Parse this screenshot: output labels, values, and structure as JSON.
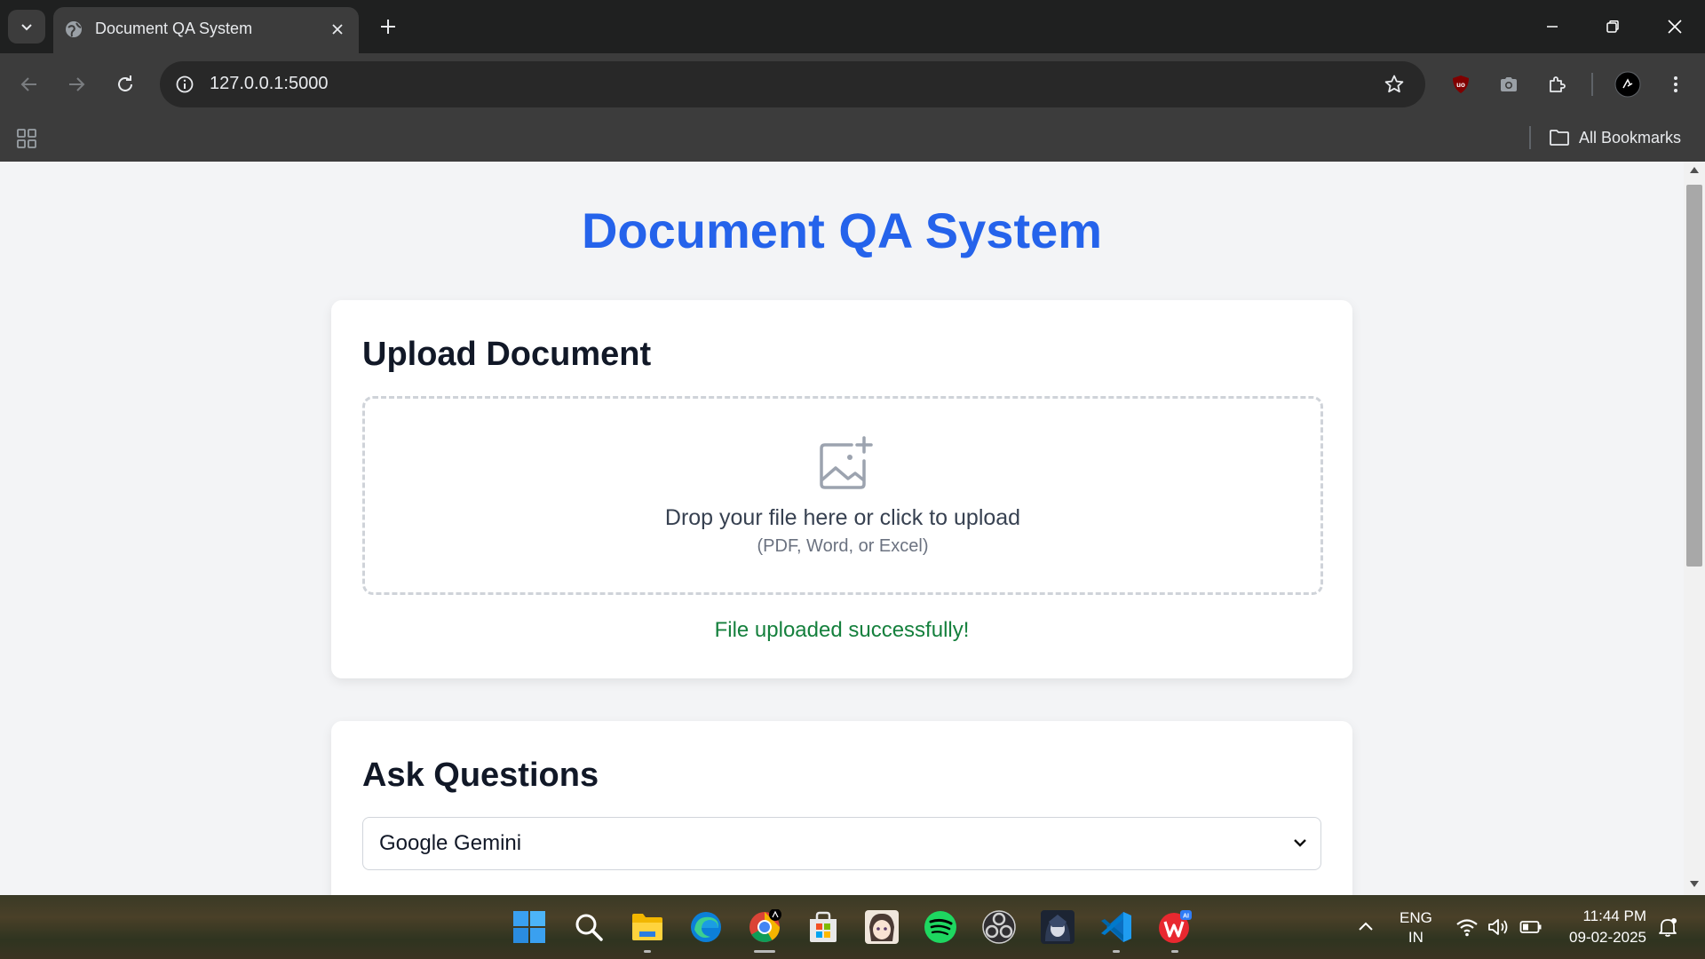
{
  "browser": {
    "tab_title": "Document QA System",
    "url": "127.0.0.1:5000",
    "bookmarks_label": "All Bookmarks"
  },
  "page": {
    "title": "Document QA System",
    "upload": {
      "heading": "Upload Document",
      "drop_text": "Drop your file here or click to upload",
      "drop_subtext": "(PDF, Word, or Excel)",
      "status": "File uploaded successfully!"
    },
    "qa": {
      "heading": "Ask Questions",
      "model_selected": "Google Gemini"
    }
  },
  "taskbar": {
    "lang_top": "ENG",
    "lang_bottom": "IN",
    "time": "11:44 PM",
    "date": "09-02-2025",
    "apps": [
      "windows-start",
      "search",
      "file-explorer",
      "edge",
      "chrome",
      "microsoft-store",
      "anime-app",
      "spotify",
      "obs",
      "game-app",
      "vs-code",
      "wps-office"
    ]
  },
  "colors": {
    "accent": "#2563eb",
    "success": "#15803d",
    "chrome_dark": "#1f2020",
    "chrome_toolbar": "#3c3c3c"
  }
}
